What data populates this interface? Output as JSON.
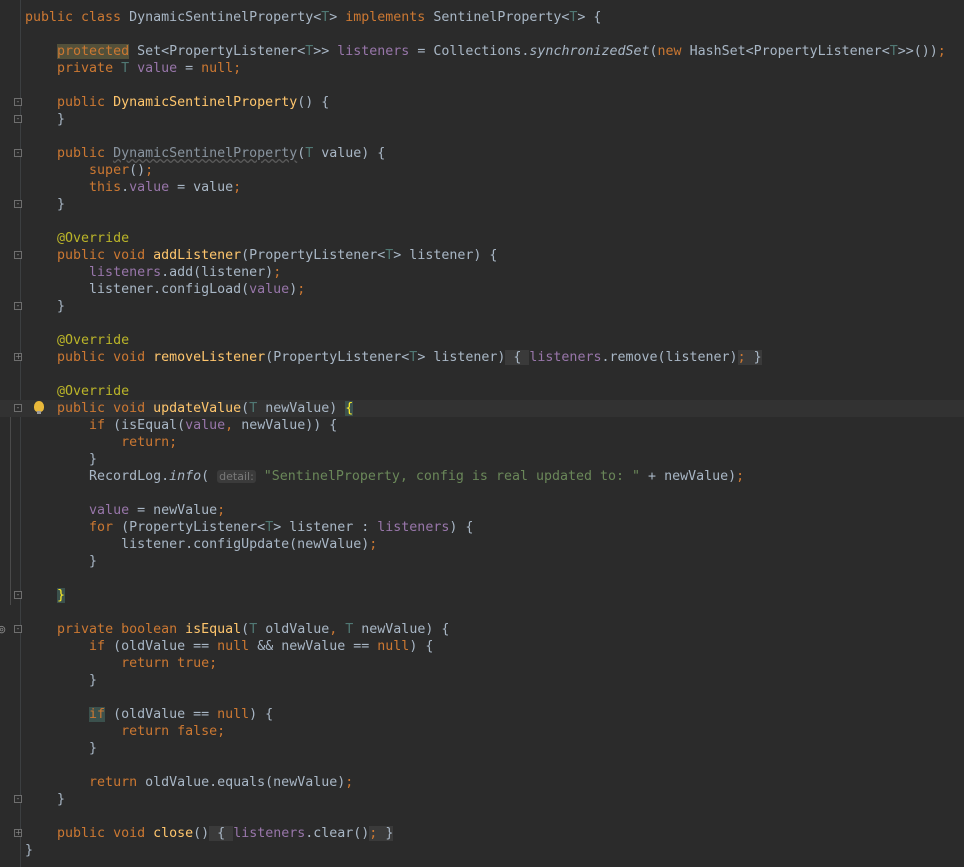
{
  "editor": {
    "current_line": 24,
    "fold_markers": {
      "6": "-",
      "7": "-",
      "9": "-",
      "12": "-",
      "15": "-",
      "18": "-",
      "21": "+",
      "24": "-",
      "35": "-",
      "37": "-",
      "47": "-",
      "49": "+"
    },
    "intention_bulb_line": 24,
    "override_marker_line": 37,
    "override_marker_icon": "implements-icon",
    "lines": [
      [
        [
          "k",
          "public class "
        ],
        [
          "p",
          "DynamicSentinelProperty<"
        ],
        [
          "g",
          "T"
        ],
        [
          "p",
          "> "
        ],
        [
          "k",
          "implements "
        ],
        [
          "p",
          "SentinelProperty<"
        ],
        [
          "g",
          "T"
        ],
        [
          "p",
          "> {"
        ]
      ],
      [],
      [
        [
          "p",
          "    "
        ],
        [
          "kb",
          "protected"
        ],
        [
          "p",
          " Set<PropertyListener<"
        ],
        [
          "g",
          "T"
        ],
        [
          "p",
          ">> "
        ],
        [
          "f",
          "listeners"
        ],
        [
          "p",
          " = Collections."
        ],
        [
          "i",
          "synchronizedSet"
        ],
        [
          "p",
          "("
        ],
        [
          "k",
          "new "
        ],
        [
          "p",
          "HashSet<PropertyListener<"
        ],
        [
          "g",
          "T"
        ],
        [
          "p",
          ">>())"
        ],
        [
          "k",
          ";"
        ]
      ],
      [
        [
          "p",
          "    "
        ],
        [
          "k",
          "private "
        ],
        [
          "g",
          "T "
        ],
        [
          "f",
          "value"
        ],
        [
          "p",
          " = "
        ],
        [
          "k",
          "null;"
        ]
      ],
      [],
      [
        [
          "p",
          "    "
        ],
        [
          "k",
          "public "
        ],
        [
          "m",
          "DynamicSentinelProperty"
        ],
        [
          "p",
          "() {"
        ]
      ],
      [
        [
          "p",
          "    }"
        ]
      ],
      [],
      [
        [
          "p",
          "    "
        ],
        [
          "k",
          "public "
        ],
        [
          "u",
          "DynamicSentinelProperty"
        ],
        [
          "p",
          "("
        ],
        [
          "g",
          "T "
        ],
        [
          "p",
          "value) {"
        ]
      ],
      [
        [
          "p",
          "        "
        ],
        [
          "k",
          "super"
        ],
        [
          "p",
          "()"
        ],
        [
          "k",
          ";"
        ]
      ],
      [
        [
          "p",
          "        "
        ],
        [
          "k",
          "this"
        ],
        [
          "p",
          "."
        ],
        [
          "f",
          "value"
        ],
        [
          "p",
          " = value"
        ],
        [
          "k",
          ";"
        ]
      ],
      [
        [
          "p",
          "    }"
        ]
      ],
      [],
      [
        [
          "p",
          "    "
        ],
        [
          "a",
          "@Override"
        ]
      ],
      [
        [
          "p",
          "    "
        ],
        [
          "k",
          "public void "
        ],
        [
          "m",
          "addListener"
        ],
        [
          "p",
          "(PropertyListener<"
        ],
        [
          "g",
          "T"
        ],
        [
          "p",
          "> listener) {"
        ]
      ],
      [
        [
          "p",
          "        "
        ],
        [
          "f",
          "listeners"
        ],
        [
          "p",
          ".add(listener)"
        ],
        [
          "k",
          ";"
        ]
      ],
      [
        [
          "p",
          "        listener.configLoad("
        ],
        [
          "f",
          "value"
        ],
        [
          "p",
          ")"
        ],
        [
          "k",
          ";"
        ]
      ],
      [
        [
          "p",
          "    }"
        ]
      ],
      [],
      [
        [
          "p",
          "    "
        ],
        [
          "a",
          "@Override"
        ]
      ],
      [
        [
          "p",
          "    "
        ],
        [
          "k",
          "public void "
        ],
        [
          "m",
          "removeListener"
        ],
        [
          "p",
          "(PropertyListener<"
        ],
        [
          "g",
          "T"
        ],
        [
          "p",
          "> listener)"
        ],
        [
          "fold",
          " { "
        ],
        [
          "f",
          "listeners"
        ],
        [
          "p",
          ".remove(listener)"
        ],
        [
          "foldk",
          ";"
        ],
        [
          "fold",
          " }"
        ]
      ],
      [],
      [
        [
          "p",
          "    "
        ],
        [
          "a",
          "@Override"
        ]
      ],
      [
        [
          "p",
          "    "
        ],
        [
          "k",
          "public void "
        ],
        [
          "m",
          "updateValue"
        ],
        [
          "p",
          "("
        ],
        [
          "g",
          "T "
        ],
        [
          "p",
          "newValue) "
        ],
        [
          "bb",
          "{"
        ]
      ],
      [
        [
          "p",
          "        "
        ],
        [
          "k",
          "if "
        ],
        [
          "p",
          "(isEqual("
        ],
        [
          "f",
          "value"
        ],
        [
          "k",
          ", "
        ],
        [
          "p",
          "newValue)) {"
        ]
      ],
      [
        [
          "p",
          "            "
        ],
        [
          "k",
          "return;"
        ]
      ],
      [
        [
          "p",
          "        }"
        ]
      ],
      [
        [
          "p",
          "        RecordLog."
        ],
        [
          "i",
          "info"
        ],
        [
          "p",
          "( "
        ],
        [
          "h",
          "detail:"
        ],
        [
          "s",
          " \"SentinelProperty, config is real updated to: \""
        ],
        [
          "p",
          " + newValue)"
        ],
        [
          "k",
          ";"
        ]
      ],
      [],
      [
        [
          "p",
          "        "
        ],
        [
          "f",
          "value"
        ],
        [
          "p",
          " = newValue"
        ],
        [
          "k",
          ";"
        ]
      ],
      [
        [
          "p",
          "        "
        ],
        [
          "k",
          "for "
        ],
        [
          "p",
          "(PropertyListener<"
        ],
        [
          "g",
          "T"
        ],
        [
          "p",
          "> listener : "
        ],
        [
          "f",
          "listeners"
        ],
        [
          "p",
          ") {"
        ]
      ],
      [
        [
          "p",
          "            listener.configUpdate(newValue)"
        ],
        [
          "k",
          ";"
        ]
      ],
      [
        [
          "p",
          "        }"
        ]
      ],
      [],
      [
        [
          "p",
          "    "
        ],
        [
          "bb",
          "}"
        ]
      ],
      [],
      [
        [
          "p",
          "    "
        ],
        [
          "k",
          "private boolean "
        ],
        [
          "m",
          "isEqual"
        ],
        [
          "p",
          "("
        ],
        [
          "g",
          "T "
        ],
        [
          "p",
          "oldValue"
        ],
        [
          "k",
          ", "
        ],
        [
          "g",
          "T "
        ],
        [
          "p",
          "newValue) {"
        ]
      ],
      [
        [
          "p",
          "        "
        ],
        [
          "k",
          "if "
        ],
        [
          "p",
          "(oldValue == "
        ],
        [
          "k",
          "null "
        ],
        [
          "p",
          "&& newValue == "
        ],
        [
          "k",
          "null"
        ],
        [
          "p",
          ") {"
        ]
      ],
      [
        [
          "p",
          "            "
        ],
        [
          "k",
          "return true;"
        ]
      ],
      [
        [
          "p",
          "        }"
        ]
      ],
      [],
      [
        [
          "p",
          "        "
        ],
        [
          "ib",
          "if"
        ],
        [
          "p",
          " (oldValue == "
        ],
        [
          "k",
          "null"
        ],
        [
          "p",
          ") {"
        ]
      ],
      [
        [
          "p",
          "            "
        ],
        [
          "k",
          "return false;"
        ]
      ],
      [
        [
          "p",
          "        }"
        ]
      ],
      [],
      [
        [
          "p",
          "        "
        ],
        [
          "k",
          "return "
        ],
        [
          "p",
          "oldValue.equals(newValue)"
        ],
        [
          "k",
          ";"
        ]
      ],
      [
        [
          "p",
          "    }"
        ]
      ],
      [],
      [
        [
          "p",
          "    "
        ],
        [
          "k",
          "public void "
        ],
        [
          "m",
          "close"
        ],
        [
          "p",
          "()"
        ],
        [
          "fold",
          " { "
        ],
        [
          "f",
          "listeners"
        ],
        [
          "p",
          ".clear()"
        ],
        [
          "foldk",
          ";"
        ],
        [
          "fold",
          " }"
        ]
      ],
      [
        [
          "p",
          "}"
        ]
      ]
    ]
  }
}
